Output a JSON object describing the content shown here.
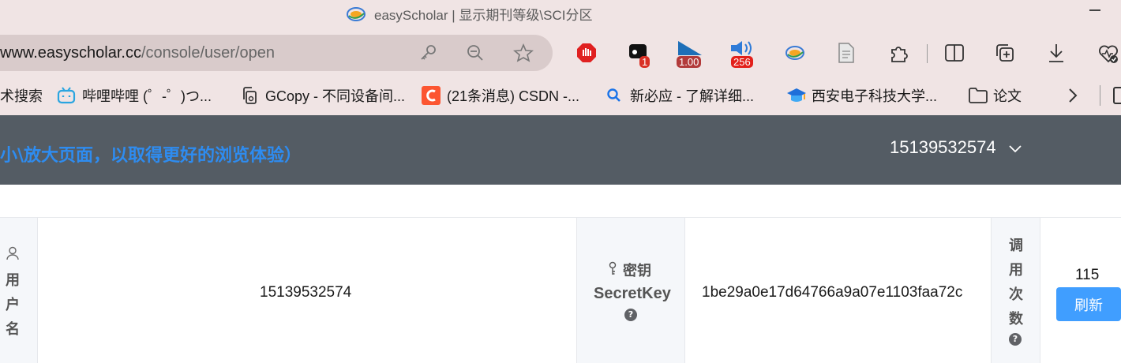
{
  "window": {
    "title": "easyScholar | 显示期刊等级\\SCI分区"
  },
  "addressbar": {
    "url_host": "www.easyscholar.cc",
    "url_path": "/console/user/open",
    "icons": [
      "key-icon",
      "zoom-out-icon",
      "favorite-star-icon"
    ]
  },
  "toolbar": {
    "extensions": [
      {
        "name": "adblock-icon"
      },
      {
        "name": "extension-badge-icon",
        "badge": "1"
      },
      {
        "name": "speed-extension-icon",
        "badge": "1.00"
      },
      {
        "name": "volume-extension-icon",
        "badge": "256"
      },
      {
        "name": "easyscholar-icon"
      },
      {
        "name": "document-icon"
      },
      {
        "name": "extensions-puzzle-icon"
      },
      {
        "name": "split-screen-icon"
      },
      {
        "name": "collections-icon"
      },
      {
        "name": "download-icon"
      },
      {
        "name": "browser-essentials-icon"
      }
    ],
    "colors": {
      "adblock": "#e02020",
      "badge_red": "#d93025",
      "speed": "#1e6fb8"
    }
  },
  "bookmarks": [
    {
      "label": "术搜索",
      "icon": "none"
    },
    {
      "label": "哔哩哔哩 (゜-゜)つ...",
      "icon": "bilibili-icon"
    },
    {
      "label": "GCopy - 不同设备间...",
      "icon": "copy-icon"
    },
    {
      "label": "(21条消息) CSDN -...",
      "icon": "csdn-icon"
    },
    {
      "label": "新必应 - 了解详细...",
      "icon": "bing-search-icon"
    },
    {
      "label": "西安电子科技大学...",
      "icon": "graduation-cap-icon"
    },
    {
      "label": "论文",
      "icon": "folder-icon"
    }
  ],
  "header": {
    "notice": "小\\放大页面，以取得更好的浏览体验）",
    "username": "15139532574",
    "bg_color": "#545c64",
    "notice_color": "#2e8cf0"
  },
  "table": {
    "username_label": "用户名",
    "username_value": "15139532574",
    "secret_label": "密钥",
    "secret_label_en": "SecretKey",
    "secret_value": "1be29a0e17d64766a9a07e1103faa72c",
    "calls_label": "调用次数",
    "calls_value": "115",
    "refresh_label": "刷新",
    "refresh_color": "#409eff"
  }
}
